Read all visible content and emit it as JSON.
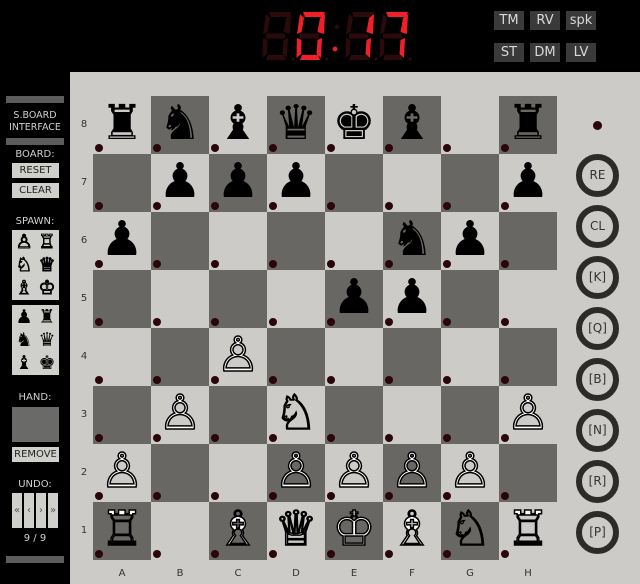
{
  "clock": {
    "display": "0:17",
    "digits": [
      "",
      "0",
      "1",
      "7"
    ],
    "colon_on": true,
    "on_color": "#f0202a",
    "off_color": "#2a0a0a"
  },
  "top_buttons": [
    {
      "id": "tm",
      "label": "TM"
    },
    {
      "id": "rv",
      "label": "RV"
    },
    {
      "id": "spk",
      "label": "spk"
    },
    {
      "id": "st",
      "label": "ST"
    },
    {
      "id": "dm",
      "label": "DM"
    },
    {
      "id": "lv",
      "label": "LV"
    }
  ],
  "left_panel": {
    "title_line1": "S.BOARD",
    "title_line2": "INTERFACE",
    "board_label": "BOARD:",
    "reset_label": "RESET",
    "clear_label": "CLEAR",
    "spawn_label": "SPAWN:",
    "spawn_white": [
      "♙",
      "♖",
      "♘",
      "♕",
      "♗",
      "♔"
    ],
    "spawn_black": [
      "♟",
      "♜",
      "♞",
      "♛",
      "♝",
      "♚"
    ],
    "hand_label": "HAND:",
    "remove_label": "REMOVE",
    "undo_label": "UNDO:",
    "undo_buttons": [
      "«",
      "‹",
      "›",
      "»"
    ],
    "undo_position": "9 / 9"
  },
  "board": {
    "files": [
      "A",
      "B",
      "C",
      "D",
      "E",
      "F",
      "G",
      "H"
    ],
    "ranks": [
      "8",
      "7",
      "6",
      "5",
      "4",
      "3",
      "2",
      "1"
    ],
    "light_color": "#cccbc7",
    "dark_color": "#686763",
    "position": {
      "a8": "bR",
      "b8": "bN",
      "c8": "bB",
      "d8": "bQ",
      "e8": "bK",
      "f8": "bB",
      "h8": "bR",
      "b7": "bP",
      "c7": "bP",
      "d7": "bP",
      "h7": "bP",
      "a6": "bP",
      "f6": "bN",
      "g6": "bP",
      "e5": "bP",
      "f5": "bP",
      "c4": "wP",
      "b3": "wP",
      "d3": "wN",
      "h3": "wP",
      "a2": "wP",
      "d2": "wP",
      "e2": "wP",
      "f2": "wP",
      "g2": "wP",
      "a1": "wR",
      "c1": "wB",
      "d1": "wQ",
      "e1": "wK",
      "f1": "wB",
      "g1": "wN",
      "h1": "wR"
    },
    "glyphs": {
      "wK": "♔",
      "wQ": "♕",
      "wR": "♖",
      "wB": "♗",
      "wN": "♘",
      "wP": "♙",
      "bK": "♚",
      "bQ": "♛",
      "bR": "♜",
      "bB": "♝",
      "bN": "♞",
      "bP": "♟"
    }
  },
  "right_buttons": [
    {
      "id": "re",
      "label": "RE"
    },
    {
      "id": "cl",
      "label": "CL"
    },
    {
      "id": "k",
      "label": "[K]"
    },
    {
      "id": "q",
      "label": "[Q]"
    },
    {
      "id": "b",
      "label": "[B]"
    },
    {
      "id": "n",
      "label": "[N]"
    },
    {
      "id": "r",
      "label": "[R]"
    },
    {
      "id": "p",
      "label": "[P]"
    }
  ]
}
